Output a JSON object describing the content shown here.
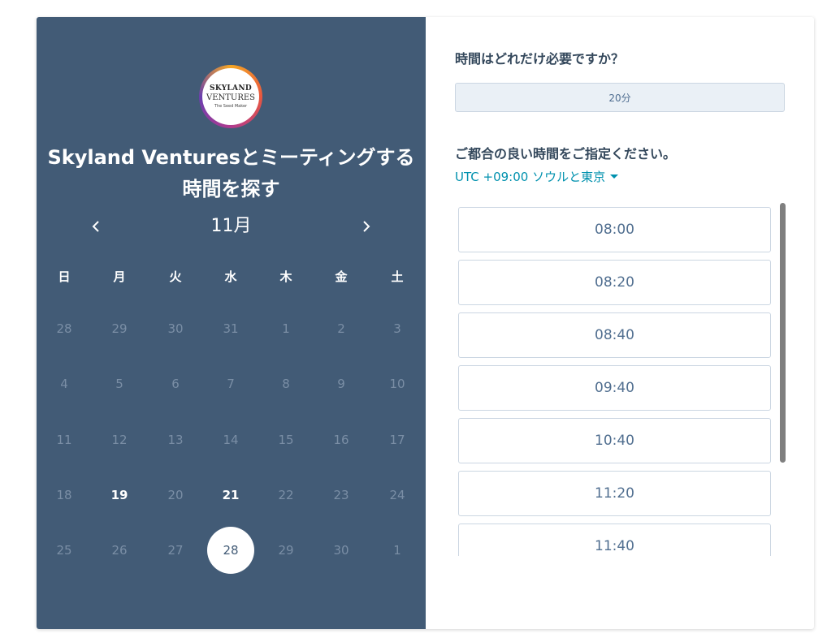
{
  "brand": {
    "logo_name": "SKYLAND",
    "logo_mark": "VENTURES",
    "logo_tagline": "The Seed Maker"
  },
  "left": {
    "title": "Skyland Venturesとミーティングする時間を探す",
    "month": "11月",
    "prev_icon": "chevron-left-icon",
    "next_icon": "chevron-right-icon",
    "weekdays": [
      "日",
      "月",
      "火",
      "水",
      "木",
      "金",
      "土"
    ],
    "weeks": [
      [
        "28",
        "29",
        "30",
        "31",
        "1",
        "2",
        "3"
      ],
      [
        "4",
        "5",
        "6",
        "7",
        "8",
        "9",
        "10"
      ],
      [
        "11",
        "12",
        "13",
        "14",
        "15",
        "16",
        "17"
      ],
      [
        "18",
        "19",
        "20",
        "21",
        "22",
        "23",
        "24"
      ],
      [
        "25",
        "26",
        "27",
        "28",
        "29",
        "30",
        "1"
      ]
    ],
    "available_days": [
      "19",
      "21"
    ],
    "selected_day": "28"
  },
  "right": {
    "question_duration": "時間はどれだけ必要ですか？",
    "duration_value": "20分",
    "question_time": "ご都合の良い時間をご指定ください。",
    "timezone": "UTC +09:00 ソウルと東京",
    "timezone_icon": "caret-down-icon",
    "slots": [
      "08:00",
      "08:20",
      "08:40",
      "09:40",
      "10:40",
      "11:20",
      "11:40"
    ]
  },
  "colors": {
    "panel": "#425b76",
    "accent": "#0091ae",
    "text_dark": "#33475b",
    "muted_day": "#7a8ea5"
  }
}
